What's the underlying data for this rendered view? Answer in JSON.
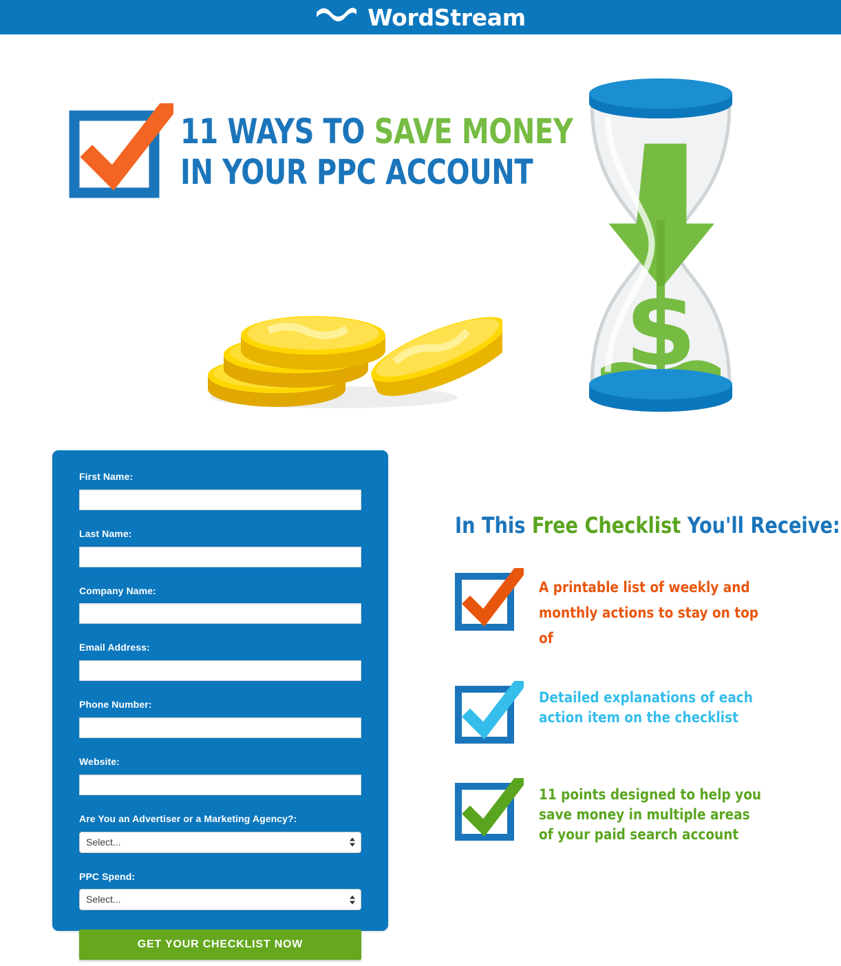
{
  "brand": {
    "name": "WordStream",
    "logo_icon": "wave-logo-icon",
    "bar_color": "#0b77bd"
  },
  "hero": {
    "checkbox_icon": "checkbox-checked-icon",
    "headline_line1_part1": "11 WAYS TO ",
    "headline_line1_accent": "SAVE MONEY",
    "headline_line2": "IN YOUR PPC ACCOUNT",
    "headline_blue": "#1b75bb",
    "headline_green": "#76bc43",
    "coins_illustration": "gold-coins-illustration",
    "hourglass_illustration": "hourglass-money-illustration"
  },
  "form": {
    "panel_color": "#0b77bd",
    "fields": [
      {
        "label": "First Name:",
        "value": "",
        "placeholder": "",
        "type": "text",
        "name": "first-name"
      },
      {
        "label": "Last Name:",
        "value": "",
        "placeholder": "",
        "type": "text",
        "name": "last-name"
      },
      {
        "label": "Company Name:",
        "value": "",
        "placeholder": "",
        "type": "text",
        "name": "company-name"
      },
      {
        "label": "Email Address:",
        "value": "",
        "placeholder": "",
        "type": "text",
        "name": "email-address"
      },
      {
        "label": "Phone Number:",
        "value": "",
        "placeholder": "",
        "type": "text",
        "name": "phone-number"
      },
      {
        "label": "Website:",
        "value": "",
        "placeholder": "",
        "type": "text",
        "name": "website"
      }
    ],
    "selects": [
      {
        "label": "Are You an Advertiser or a Marketing Agency?:",
        "value": "Select...",
        "name": "advertiser-or-agency"
      },
      {
        "label": "PPC Spend:",
        "value": "Select...",
        "name": "ppc-spend"
      }
    ],
    "submit_label": "GET YOUR CHECKLIST NOW",
    "submit_color": "#65a81e"
  },
  "benefits": {
    "title_part1": "In This ",
    "title_accent": "Free Checklist",
    "title_part2": " You'll Receive:",
    "items": [
      {
        "text": "A printable list of weekly and monthly actions to stay on top of",
        "color": "#e8560e",
        "check_color": "#e8560e",
        "icon": "checkbox-checked-icon"
      },
      {
        "text": "Detailed explanations of each action item on the checklist",
        "color": "#35bdeb",
        "check_color": "#35bdeb",
        "icon": "checkbox-checked-icon"
      },
      {
        "text": "11 points designed to help you save money in multiple areas of your paid search account",
        "color": "#5aa520",
        "check_color": "#5aa520",
        "icon": "checkbox-checked-icon"
      }
    ]
  }
}
